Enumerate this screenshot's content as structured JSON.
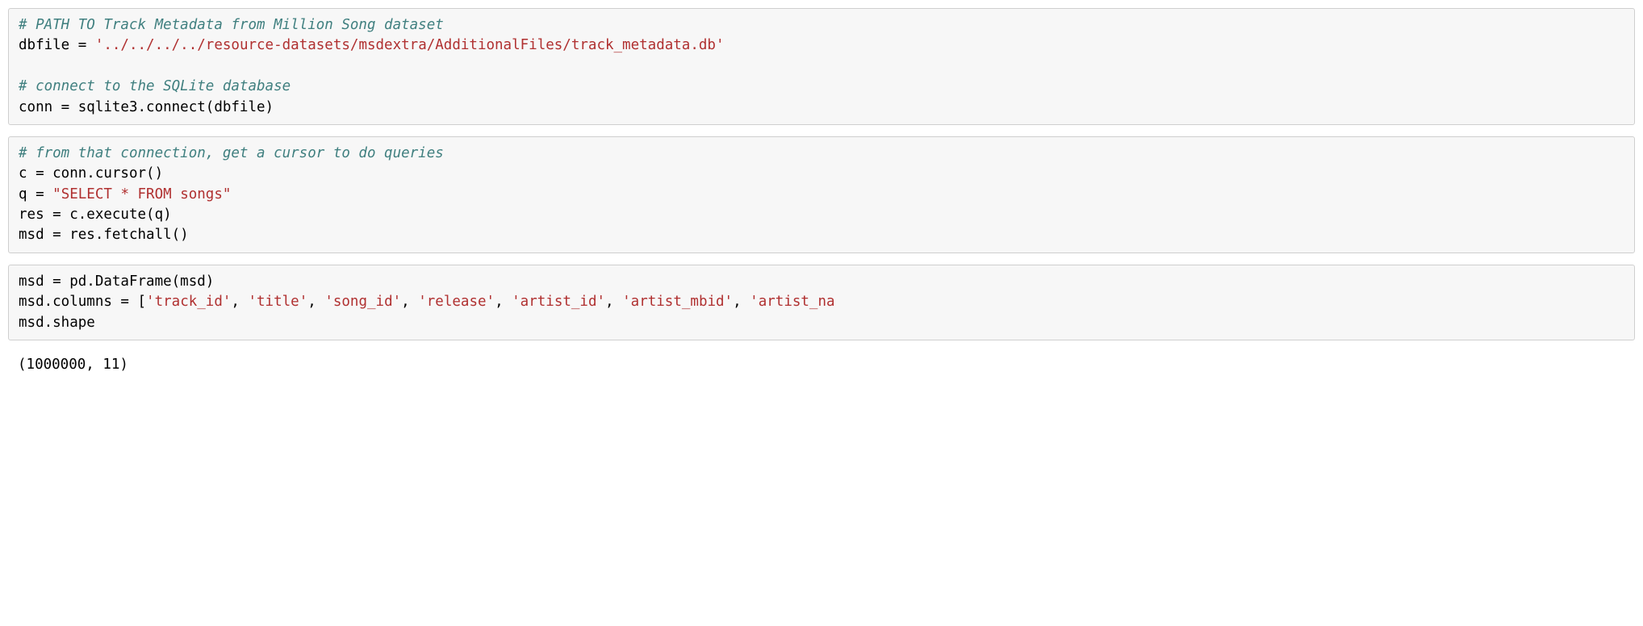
{
  "cell1": {
    "comment1": "# PATH TO Track Metadata from Million Song dataset",
    "line2_pre": "dbfile = ",
    "line2_str": "'../../../../resource-datasets/msdextra/AdditionalFiles/track_metadata.db'",
    "blank": "",
    "comment2": "# connect to the SQLite database",
    "line5": "conn = sqlite3.connect(dbfile)"
  },
  "cell2": {
    "comment1": "# from that connection, get a cursor to do queries",
    "line2": "c = conn.cursor()",
    "line3_pre": "q = ",
    "line3_str": "\"SELECT * FROM songs\"",
    "line4": "res = c.execute(q)",
    "line5": "msd = res.fetchall()"
  },
  "cell3": {
    "line1": "msd = pd.DataFrame(msd)",
    "line2_pre": "msd.columns = [",
    "cols_s1": "'track_id'",
    "sep": ", ",
    "cols_s2": "'title'",
    "cols_s3": "'song_id'",
    "cols_s4": "'release'",
    "cols_s5": "'artist_id'",
    "cols_s6": "'artist_mbid'",
    "cols_s7": "'artist_na",
    "line3": "msd.shape"
  },
  "output1": "(1000000, 11)"
}
